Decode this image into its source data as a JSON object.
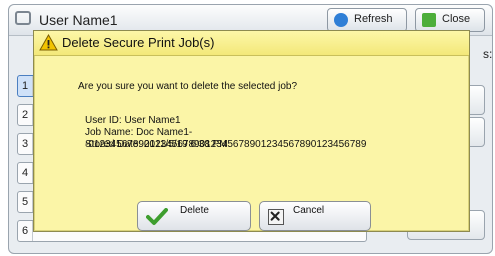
{
  "background": {
    "title": "User Name1",
    "refresh_label": "Refresh",
    "close_label": "Close",
    "colon": "s:",
    "rows": [
      "1",
      "2",
      "3",
      "4",
      "5",
      "6"
    ]
  },
  "dialog": {
    "title": "Delete Secure Print Job(s)",
    "message": "Are you sure you want to delete the selected job?",
    "user_id": "User ID: User Name1",
    "job_name": "Job Name: Doc Name1--01234567890123456789012345678901234567890123456789",
    "stored_date": "Stored Date: 2011/5/19 6:38 PM",
    "delete_label": "Delete",
    "cancel_label": "Cancel"
  },
  "colors": {
    "dialog_bg": "#fbf5a7",
    "warning": "#f2c300",
    "selection": "#cfe1f8"
  }
}
